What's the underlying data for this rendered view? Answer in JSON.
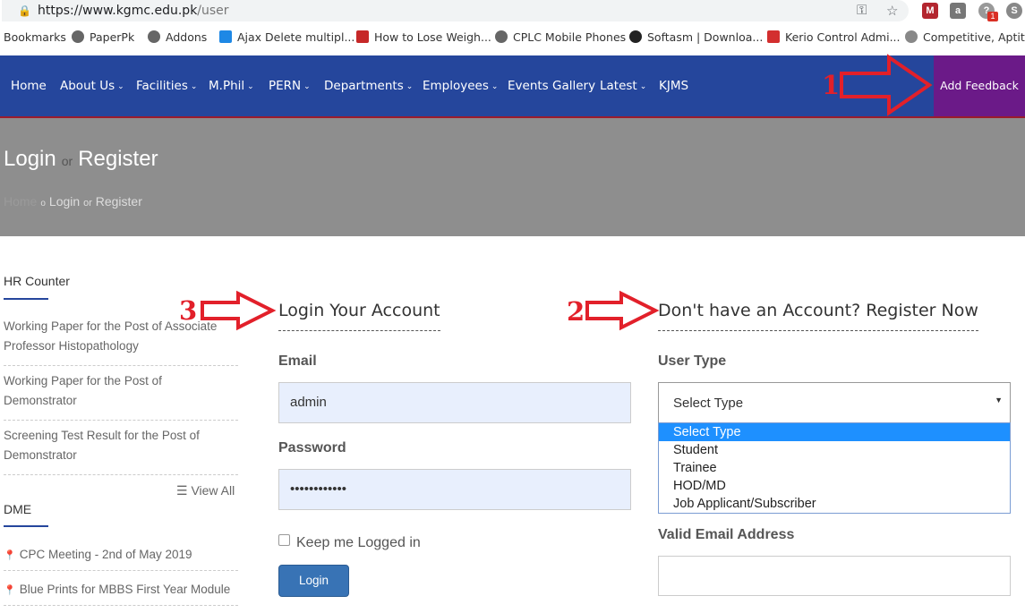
{
  "browser": {
    "url_host": "https://www.kgmc.edu.pk",
    "url_path": "/user",
    "bookmarks": [
      {
        "label": "Bookmarks",
        "icon": "none"
      },
      {
        "label": "PaperPk",
        "icon": "globe-icon"
      },
      {
        "label": "Addons",
        "icon": "globe-icon"
      },
      {
        "label": "Ajax Delete multipl...",
        "icon": "w-icon"
      },
      {
        "label": "How to Lose Weigh...",
        "icon": "news-icon"
      },
      {
        "label": "CPLC Mobile Phones",
        "icon": "globe-icon"
      },
      {
        "label": "Softasm | Downloa...",
        "icon": "download-icon"
      },
      {
        "label": "Kerio Control Admi...",
        "icon": "kerio-icon"
      },
      {
        "label": "Competitive, Aptitu...",
        "icon": "g-icon"
      }
    ],
    "badge_count": "1"
  },
  "nav": {
    "items": [
      {
        "label": "Home",
        "dropdown": false
      },
      {
        "label": "About Us",
        "dropdown": true
      },
      {
        "label": "Facilities",
        "dropdown": true
      },
      {
        "label": "M.Phil",
        "dropdown": true
      },
      {
        "label": "PERN",
        "dropdown": true
      },
      {
        "label": "Departments",
        "dropdown": true
      },
      {
        "label": "Employees",
        "dropdown": true
      },
      {
        "label": "Events Gallery",
        "dropdown": false
      },
      {
        "label": "Latest",
        "dropdown": true
      },
      {
        "label": "KJMS",
        "dropdown": false
      }
    ],
    "feedback": "Add Feedback",
    "caret": "⌄"
  },
  "hero": {
    "title_login": "Login",
    "title_or": "or",
    "title_register": "Register",
    "crumb_home": "Home",
    "crumb_sep": "o",
    "crumb_login": "Login",
    "crumb_or": "or",
    "crumb_register": "Register"
  },
  "sidebar": {
    "hr_title": "HR Counter",
    "hr_links": [
      "Working Paper for the Post of Associate Professor Histopathology",
      "Working Paper for the Post of Demonstrator",
      "Screening Test Result for the Post of Demonstrator"
    ],
    "view_all": "View All",
    "dme_title": "DME",
    "dme_links": [
      "CPC Meeting - 2nd of May 2019",
      "Blue Prints for MBBS First Year Module"
    ]
  },
  "login": {
    "title": "Login Your Account",
    "email_label": "Email",
    "email_value": "admin",
    "password_label": "Password",
    "password_value": "••••••••••••",
    "remember_label": "Keep me Logged in",
    "button": "Login"
  },
  "register": {
    "title": "Don't have an Account? Register Now",
    "user_type_label": "User Type",
    "user_type_selected": "Select Type",
    "options": [
      "Select Type",
      "Student",
      "Trainee",
      "HOD/MD",
      "Job Applicant/Subscriber"
    ],
    "email_label": "Valid Email Address"
  },
  "annotations": {
    "n1": "1",
    "n2": "2",
    "n3": "3",
    "color": "#e2202a"
  },
  "colors": {
    "nav_bg": "#25469c",
    "feedback_bg": "#6b1a88",
    "hero_bg": "#8e8e8e",
    "button_bg": "#3873b5"
  }
}
